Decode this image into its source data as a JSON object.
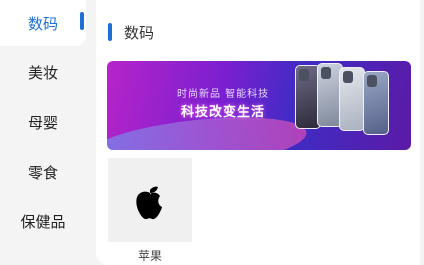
{
  "sidebar": {
    "items": [
      {
        "label": "数码",
        "active": true
      },
      {
        "label": "美妆",
        "active": false
      },
      {
        "label": "母婴",
        "active": false
      },
      {
        "label": "零食",
        "active": false
      },
      {
        "label": "保健品",
        "active": false
      }
    ]
  },
  "section": {
    "title": "数码"
  },
  "banner": {
    "subtitle": "时尚新品 智能科技",
    "headline": "科技改变生活"
  },
  "brands": [
    {
      "label": "苹果",
      "icon": "apple-logo-icon"
    }
  ],
  "colors": {
    "accent": "#1f6fd6",
    "sidebar_bg": "#f4f4f5",
    "content_bg": "#ffffff"
  }
}
